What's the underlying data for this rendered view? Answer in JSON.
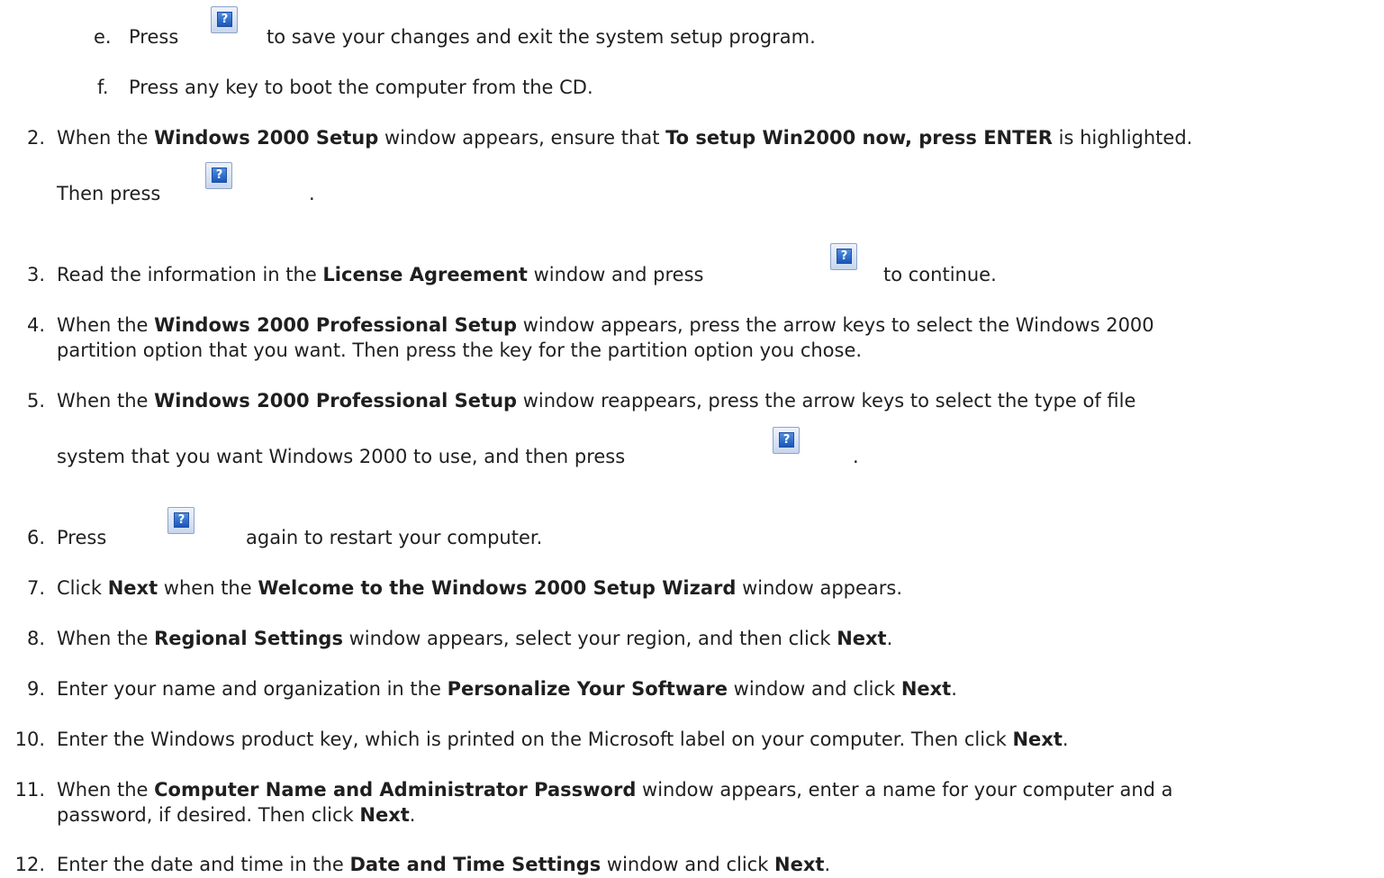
{
  "substeps": [
    {
      "letter": "e.",
      "pre": "Press",
      "post": "to save your changes and exit the system setup program."
    },
    {
      "letter": "f.",
      "text": "Press any key to boot the computer from the CD."
    }
  ],
  "key_icon": {
    "glyph": "?",
    "name": "missing-image-icon"
  },
  "steps": {
    "s2": {
      "num": "2.",
      "a": "When the ",
      "b1": "Windows 2000 Setup",
      "c": " window appears, ensure that ",
      "b2": "To setup Win2000 now, press ENTER",
      "d": " is highlighted.",
      "line2_pre": "Then press",
      "line2_post": "."
    },
    "s3": {
      "num": "3.",
      "a": "Read the information in the ",
      "b1": "License Agreement",
      "c": " window and press",
      "post": "to continue."
    },
    "s4": {
      "num": "4.",
      "a": "When the ",
      "b1": "Windows 2000 Professional Setup",
      "c": " window appears, press the arrow keys to select the Windows 2000",
      "line2": "partition option that you want. Then press the key for the partition option you chose."
    },
    "s5": {
      "num": "5.",
      "a": "When the ",
      "b1": "Windows 2000 Professional Setup",
      "c": " window reappears, press the arrow keys to select the type of file",
      "line2_pre": "system that you want Windows 2000 to use, and then press",
      "line2_post": "."
    },
    "s6": {
      "num": "6.",
      "pre": "Press",
      "post": "again to restart your computer."
    },
    "s7": {
      "num": "7.",
      "a": "Click ",
      "b1": "Next",
      "c": " when the ",
      "b2": "Welcome to the Windows 2000 Setup Wizard",
      "d": " window appears."
    },
    "s8": {
      "num": "8.",
      "a": "When the ",
      "b1": "Regional Settings",
      "c": " window appears, select your region, and then click ",
      "b2": "Next",
      "d": "."
    },
    "s9": {
      "num": "9.",
      "a": "Enter your name and organization in the ",
      "b1": "Personalize Your Software",
      "c": " window and click ",
      "b2": "Next",
      "d": "."
    },
    "s10": {
      "num": "10.",
      "a": "Enter the Windows product key, which is printed on the Microsoft label on your computer. Then click ",
      "b1": "Next",
      "c": "."
    },
    "s11": {
      "num": "11.",
      "a": "When the ",
      "b1": "Computer Name and Administrator Password",
      "c": " window appears, enter a name for your computer and a",
      "line2_a": "password, if desired. Then click ",
      "line2_b": "Next",
      "line2_c": "."
    },
    "s12": {
      "num": "12.",
      "a": "Enter the date and time in the ",
      "b1": "Date and Time Settings",
      "c": " window and click ",
      "b2": "Next",
      "d": "."
    }
  }
}
